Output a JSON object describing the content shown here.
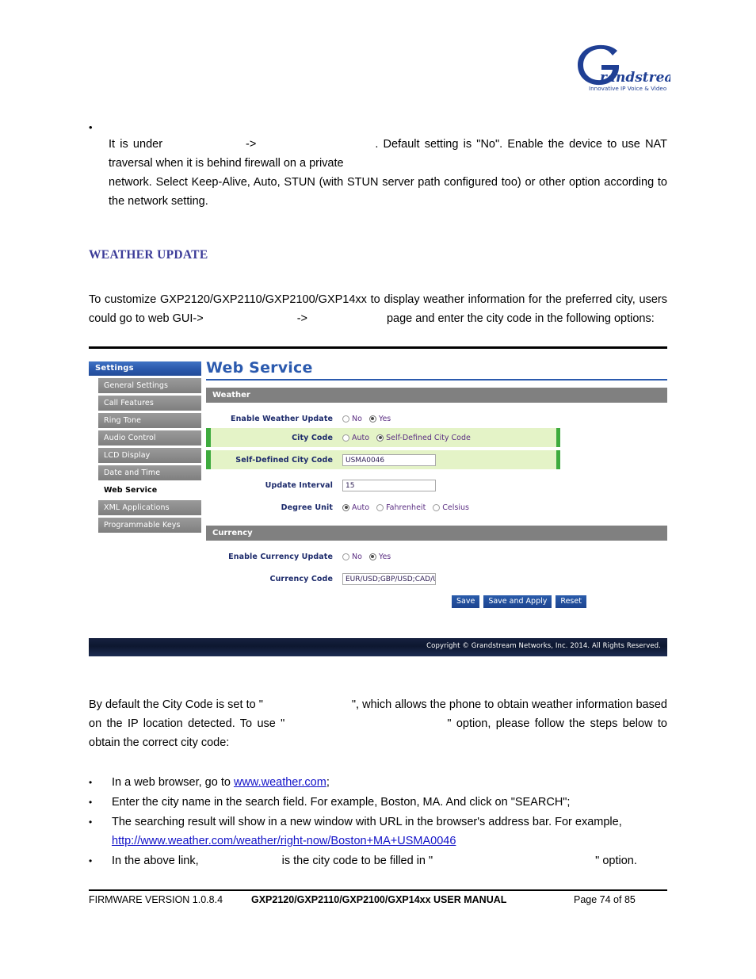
{
  "logo": {
    "brand": "Grandstream",
    "tagline": "Innovative IP Voice & Video",
    "color": "#1F3F94"
  },
  "intro_bullet": {
    "line1_a": "It is under",
    "line1_b": "->",
    "line1_c": ". Default setting is \"No\". Enable the device to use NAT traversal when it is behind firewall on a private",
    "line2": "network. Select Keep-Alive, Auto, STUN (with STUN server path configured too) or other option according to the network setting."
  },
  "section": {
    "heading": "WEATHER UPDATE",
    "heading_color": "#3B3B98",
    "para_line1": "To customize GXP2120/GXP2110/GXP2100/GXP14xx to display weather information for the preferred city, users could go to web GUI->",
    "para_arrow": "->",
    "para_line2": "page and enter the city code in the following options:"
  },
  "webui": {
    "sidebar": {
      "header": "Settings",
      "items": [
        {
          "label": "General Settings",
          "active": false
        },
        {
          "label": "Call Features",
          "active": false
        },
        {
          "label": "Ring Tone",
          "active": false
        },
        {
          "label": "Audio Control",
          "active": false
        },
        {
          "label": "LCD Display",
          "active": false
        },
        {
          "label": "Date and Time",
          "active": false
        },
        {
          "label": "Web Service",
          "active": true
        },
        {
          "label": "XML Applications",
          "active": false
        },
        {
          "label": "Programmable Keys",
          "active": false
        }
      ]
    },
    "title": "Web Service",
    "weather_section": {
      "bar_label": "Weather",
      "enable_label": "Enable Weather Update",
      "enable_options": [
        {
          "label": "No",
          "selected": false
        },
        {
          "label": "Yes",
          "selected": true
        }
      ],
      "city_code_label": "City Code",
      "city_code_options": [
        {
          "label": "Auto",
          "selected": false
        },
        {
          "label": "Self-Defined City Code",
          "selected": true
        }
      ],
      "self_defined_label": "Self-Defined City Code",
      "self_defined_value": "USMA0046",
      "update_interval_label": "Update Interval",
      "update_interval_value": "15",
      "degree_unit_label": "Degree Unit",
      "degree_unit_options": [
        {
          "label": "Auto",
          "selected": true
        },
        {
          "label": "Fahrenheit",
          "selected": false
        },
        {
          "label": "Celsius",
          "selected": false
        }
      ]
    },
    "currency_section": {
      "bar_label": "Currency",
      "enable_label": "Enable Currency Update",
      "enable_options": [
        {
          "label": "No",
          "selected": false
        },
        {
          "label": "Yes",
          "selected": true
        }
      ],
      "currency_code_label": "Currency Code",
      "currency_code_value": "EUR/USD;GBP/USD;CAD/U"
    },
    "buttons": {
      "save": "Save",
      "save_and_apply": "Save and Apply",
      "reset": "Reset"
    },
    "footer_copyright": "Copyright © Grandstream Networks, Inc. 2014. All Rights Reserved.",
    "colors": {
      "title_blue": "#2B5AAE",
      "section_bar_gray": "#808080",
      "highlight_green_fill": "#E4F3C7",
      "highlight_green_border": "#3EAB3E",
      "button_blue": "#1D4490",
      "footer_navy": "#0D1730"
    }
  },
  "after_para": {
    "part1": "By default the City Code is set to \"",
    "part2": "\", which allows the phone to obtain weather information based on the IP location detected. To use \"",
    "part3": "\" option, please follow the steps below to obtain the correct city code:"
  },
  "steps": [
    {
      "text_before": "In a web browser, go to ",
      "link": "www.weather.com",
      "text_after": ";"
    },
    {
      "text_before": "Enter the city name in the search field. For example, Boston, MA. And click on \"SEARCH\";",
      "link": "",
      "text_after": ""
    },
    {
      "text_before": "The searching result will show in a new window with URL in the browser's address bar. For example,",
      "link": "http://www.weather.com/weather/right-now/Boston+MA+USMA0046",
      "text_after": ""
    },
    {
      "text_before": "In the above link,",
      "link": "",
      "text_after": "is the city code to be filled in \""
    }
  ],
  "step4_tail": "\" option.",
  "page_footer": {
    "firmware": "FIRMWARE VERSION 1.0.8.4",
    "manual": "GXP2120/GXP2110/GXP2100/GXP14xx USER MANUAL",
    "page": "Page 74 of 85"
  }
}
